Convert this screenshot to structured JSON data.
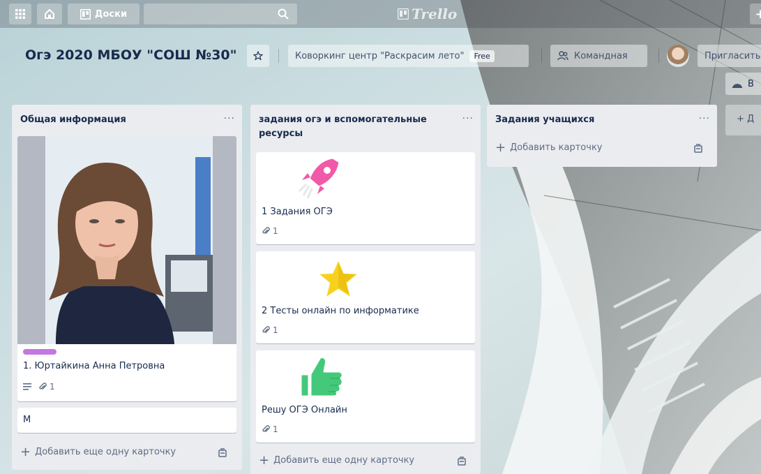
{
  "topbar": {
    "boards_label": "Доски",
    "search_placeholder": "",
    "logo_text": "Trello"
  },
  "board": {
    "title": "Огэ 2020 МБОУ \"СОШ №30\"",
    "team_label": "Коворкинг центр \"Раскрасим лето\"",
    "plan_badge": "Free",
    "visibility_label": "Командная",
    "invite_label": "Пригласить",
    "right_button_1": "В",
    "right_button_2": "+ Д"
  },
  "lists": [
    {
      "title": "Общая информация",
      "menu": "···",
      "cards": [
        {
          "text": "1. Юртайкина Анна Петровна",
          "label_color": "#c377e0",
          "attachments": "1"
        },
        {
          "text": "М"
        }
      ],
      "add_label": "Добавить еще одну карточку"
    },
    {
      "title": "задания огэ и вспомогательные ресурсы",
      "menu": "···",
      "cards": [
        {
          "text": "1 Задания ОГЭ",
          "attachments": "1",
          "sticker": "rocket-sticker"
        },
        {
          "text": "2 Тесты онлайн по информатике",
          "attachments": "1",
          "sticker": "star-sticker"
        },
        {
          "text": "Решу ОГЭ Онлайн",
          "attachments": "1",
          "sticker": "thumbs-up-sticker"
        }
      ],
      "add_label": "Добавить еще одну карточку"
    },
    {
      "title": "Задания учащихся",
      "menu": "···",
      "add_label": "Добавить карточку"
    }
  ],
  "colors": {
    "list_bg": "#ebecf0",
    "text": "#172b4d",
    "muted": "#5e6c84"
  }
}
